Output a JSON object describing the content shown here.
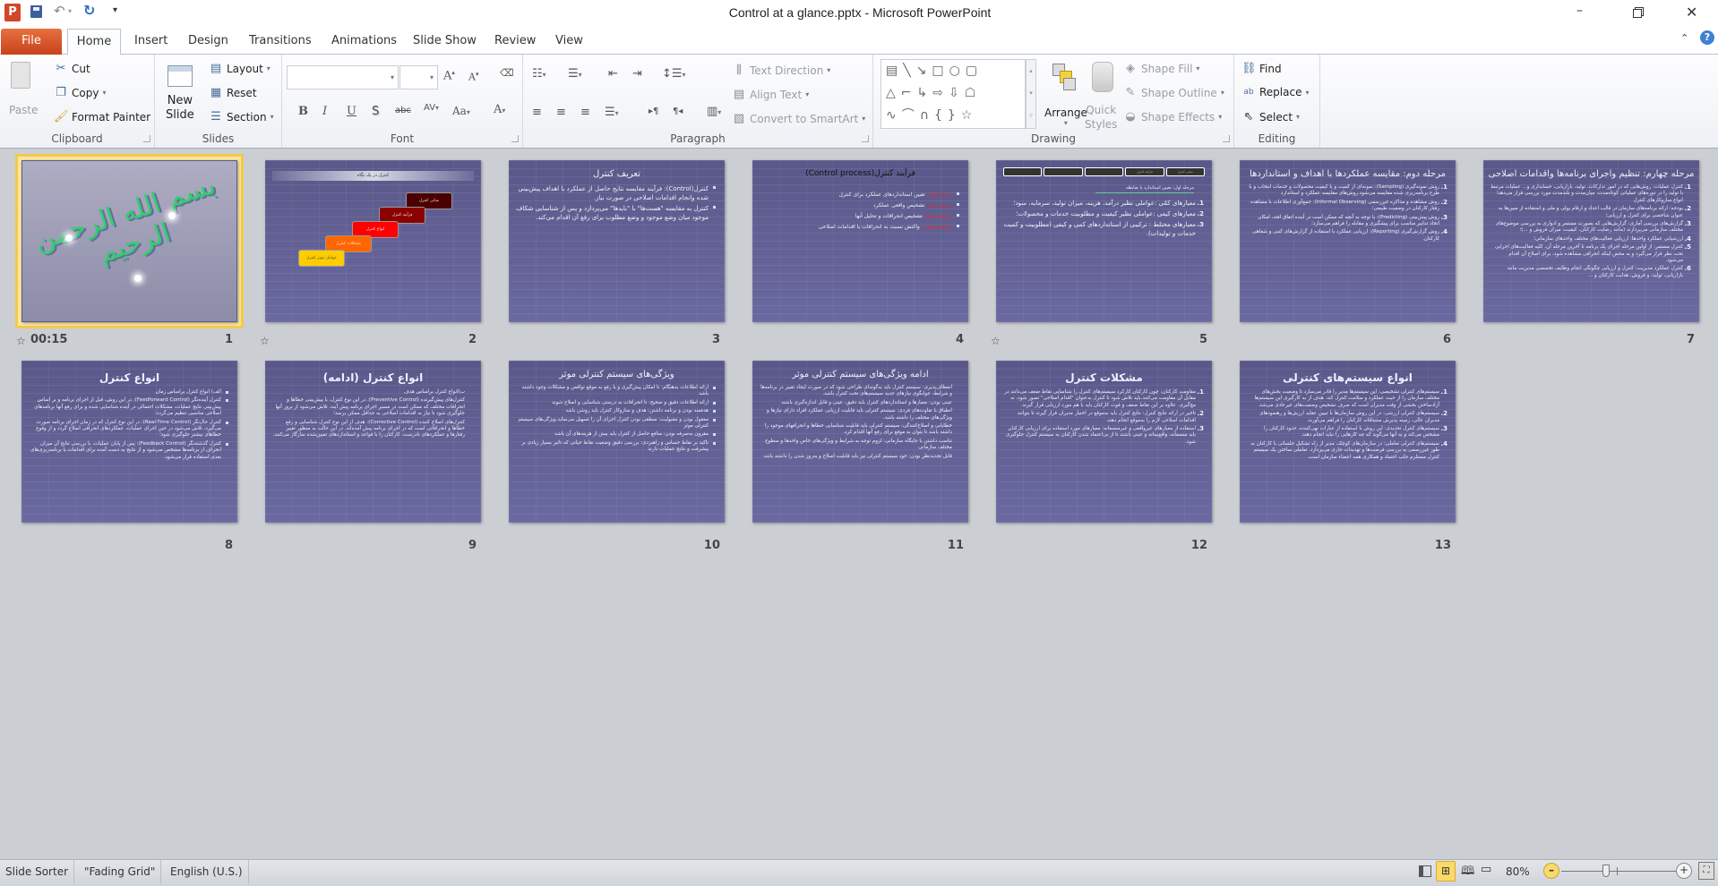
{
  "app": {
    "title": "Control at a glance.pptx  -  Microsoft PowerPoint",
    "logo": "P"
  },
  "quick_access": {
    "icons": [
      "save-icon",
      "undo-icon",
      "redo-icon",
      "customize-icon"
    ]
  },
  "tabs": [
    {
      "label": "File"
    },
    {
      "label": "Home",
      "active": true
    },
    {
      "label": "Insert"
    },
    {
      "label": "Design"
    },
    {
      "label": "Transitions"
    },
    {
      "label": "Animations"
    },
    {
      "label": "Slide Show"
    },
    {
      "label": "Review"
    },
    {
      "label": "View"
    }
  ],
  "ribbon": {
    "clipboard": {
      "label": "Clipboard",
      "paste": "Paste",
      "cut": "Cut",
      "copy": "Copy",
      "format_painter": "Format Painter"
    },
    "slides": {
      "label": "Slides",
      "new_slide_1": "New",
      "new_slide_2": "Slide",
      "layout": "Layout",
      "reset": "Reset",
      "section": "Section"
    },
    "font": {
      "label": "Font",
      "font_name": "",
      "font_size": ""
    },
    "paragraph": {
      "label": "Paragraph",
      "text_direction": "Text Direction",
      "align_text": "Align Text",
      "convert_smartart": "Convert to SmartArt"
    },
    "drawing": {
      "label": "Drawing",
      "arrange": "Arrange",
      "quick_styles_1": "Quick",
      "quick_styles_2": "Styles",
      "shape_fill": "Shape Fill",
      "shape_outline": "Shape Outline",
      "shape_effects": "Shape Effects"
    },
    "editing": {
      "label": "Editing",
      "find": "Find",
      "replace": "Replace",
      "select": "Select"
    }
  },
  "slides": [
    {
      "num": "1",
      "kind": "calligraphy",
      "calligraphy": "بسم الله الرحمن الرحیم",
      "timing": "00:15",
      "transition": true,
      "selected": true
    },
    {
      "num": "2",
      "kind": "steps",
      "header": "کنترل در یک نگاه",
      "transition": true,
      "steps": [
        {
          "label": "مبانی کنترل",
          "color": "#4a0000"
        },
        {
          "label": "فرآیند کنترل",
          "color": "#8b0000"
        },
        {
          "label": "انواع کنترل",
          "color": "#ff0000"
        },
        {
          "label": "مشکلات کنترل",
          "color": "#ff6600"
        },
        {
          "label": "عوامل موثر کنترل",
          "color": "#ffcc00"
        }
      ]
    },
    {
      "num": "3",
      "kind": "bullets",
      "large": true,
      "title": "تعریف کنترل",
      "bullets": [
        "کنترل(Control): فرآیند مقایسه نتایج حاصل از عملکرد با اهداف پیش‌بینی شده وانجام اقدامات اصلاحی در صورت نیاز.",
        "کنترل به مقایسه \"هست‌ها\" با \"بایدها\" می‌پردازد و پس از شناسایی شکاف موجود میان وضع موجود و وضع مطلوب برای رفع آن اقدام می‌کند."
      ]
    },
    {
      "num": "4",
      "kind": "stages",
      "title": "فرآیند کنترل(Control process)",
      "stages": [
        {
          "label": "مرحله اول:",
          "text": "تعیین استانداردهای عملکرد برای کنترل"
        },
        {
          "label": "مرحله دوم:",
          "text": "تشخیص واقعی عملکرد"
        },
        {
          "label": "مرحله سوم:",
          "text": "تشخیص انحرافات و تحلیل آنها"
        },
        {
          "label": "مرحله چهارم:",
          "text": "واکنش نسبت به انحرافات یا اقدامات اصلاحی"
        }
      ],
      "accent": "#ff2020"
    },
    {
      "num": "5",
      "kind": "nav",
      "transition": true,
      "nav": [
        "مبانی کنترل",
        "فرآیند کنترل",
        "",
        "",
        ""
      ],
      "subtitle": "مرحله اول: تعیین استاندارد یا ضابطه",
      "numbered": [
        "معیارهای کمّی :عواملی نظیر درآمد، هزینه، میزان تولید، سرمایه، سود؛",
        "معیارهای کیفی :عواملی نظیر کیفیت و مطلوبیت خدمات و محصولات؛",
        "معیارهای مختلط : ترکیبی از استانداردهای کمی و کیفی (مطلوبیت و کمیت خدمات و تولیدات)."
      ]
    },
    {
      "num": "6",
      "kind": "numbered",
      "title": "مرحله دوم: مقایسه عملکردها با اهداف و استانداردها",
      "numbered": [
        "روش نمونه‌گیری (Sampling): نمونه‌ای از کمیت و یا کیفیت محصولات و خدمات انتخاب و با طرح برنامه‌ریزی شده مقایسه می‌شود.روش‌های مقایسه عملکرد و استاندارد",
        "روش مشاهده و مذاکره غیررسمی (Informal Observing): جمع‌آوری اطلاعات با مشاهده رفتار کارکنان در وضعیت طبیعی؛",
        "روش پیش‌بینی (Predicting): با توجه به آنچه که ممکن است در آینده اتفاق افتد، امکان اتخاذ تدابیر مناسب برای پیشگیری و مقابله را فراهم می‌سازد؛",
        "روش گزارش‌گیری (Reporting): ارزیابی عملکرد با استفاده از گزارش‌های کتبی و شفاهی کارکنان."
      ]
    },
    {
      "num": "7",
      "kind": "numbered",
      "title": "مرحله چهارم: تنظیم واجرای برنامه‌ها واقدامات اصلاحی",
      "numbered": [
        "کنترل عملیات: روش‌هایی که در امور تدارکات، تولید، بازاریابی، حسابداری و... عملیات مرتبط با تولید را در دوره‌های عملیاتی کوتاه‌مدت، میان‌مدت و بلندمدت مورد بررسی قرار می‌دهد؛انواع سازوکارهای کنترل",
        "بودجه: ارائه برنامه‌های سازمان در قالب اعداد و ارقام پولی و ملی و استفاده از مبین‌ها به عنوان شاخصی برای کنترل و ارزیابی؛",
        "گزارش‌های بررسی آماری: گزارش‌هایی که بصورت مستمر و ادواری به بررسی موضوع‌های مختلف سازمانی می‌پردازند (مانند رضایت کارکنان، کیفیت، میزان فروش و ...)؛",
        "ارزشیابی عملکرد واحدها: ارزیابی فعالیت‌های مختلف واحدهای سازمانی؛",
        "کنترل مستمر: از اولین مرحله اجرای یک برنامه تا آخرین مرحله آن، کلیه فعالیت‌های اجرایی تحت نظر قرار می‌گیرد و به محض اینکه انحرافی مشاهده شود، برای اصلاح آن اقدام می‌شود.",
        "کنترل عملکرد مدیریت: کنترل و ارزیابی چگونگی انجام وظایف تخصصی مدیریت مانند بازاریابی، تولید، و فروش، هدایت کارکنان و ..."
      ]
    },
    {
      "num": "8",
      "kind": "bullets",
      "title": "انواع کنترل",
      "bigtitle": true,
      "bullets": [
        "الف) انواع کنترل براساس زمان",
        "کنترل آینده‌نگر (Feedforward Control): در این روش، قبل از اجرای برنامه و بر اساس پیش‌بینی نتایج عملیات، مشکلات احتمالی در آینده شناسایی شده و برای رفع آنها برنامه‌های اصلاحی مناسبی تنظیم می‌گردد؛",
        "کنترل حال‌نگر (Real-Time Control): در این نوع کنترل که در زمان اجرای برنامه صورت می‌گیرد، تلاش می‌شود در حین اجرای عملیات، عملکردهای انحرافی اصلاح گردد و از وقوع خطاهای بیشتر جلوگیری شود؛",
        "کنترل گذشته‌نگر (Feedback Control): پس از پایان عملیات، با بررسی نتایج آن میزان انحراف از برنامه‌ها مشخص می‌شود و از نتایج به دست آمده برای اقدامات یا برنامه‌ریزی‌های بعدی استفاده قرار می‌شود."
      ]
    },
    {
      "num": "9",
      "kind": "bullets",
      "title": "انواع کنترل (ادامه)",
      "bigtitle": true,
      "plain": true,
      "bullets": [
        "ب)انواع کنترل براساس هدف",
        "کنترل‌های پیش‌گیرنده (Preventive Control): در این نوع کنترل، با پیش‌بینی خطاها و انحرافات مختلف که ممکن است در مسیر اجرای برنامه پیش آیند، تلاش می‌شود از بروز آنها جلوگیری شود تا نیاز به اقدامات اصلاحی به حداقل ممکن برسد؛",
        "کنترل‌های اصلاح کننده (Corrective Control): هدف از این نوع کنترل شناسایی و رفع خطاها و انحرافاتی است که در اجرای برنامه پیش آمده‌اند. در این حالت به منظور تغییر رفتارها و عملکردهای نادرست، کارکنان را با قواعد و استانداردهای تعیین‌شده سازگار می‌کنند."
      ]
    },
    {
      "num": "10",
      "kind": "bullets",
      "title": "ویژگی‌های سیستم کنترلی موثر",
      "bullets": [
        "ارائه اطلاعات به‌هنگام: تا امکان پیش‌گیری و یا رفع به موقع نواقص و مشکلات وجود داشته باشد",
        "ارائه اطلاعات دقیق و صحیح: تا انحرافات به درستی شناسایی و اصلاح شوند",
        "هدفمند بودن و برنامه داشتن: هدف و سازوکار کنترل باید روشن باشد",
        "معقول بودن و مقبولیت: منطقی بودن کنترل اجرای آن را تسهیل می‌نماید.ویژگی‌های سیستم کنترلی موثر",
        "مقرون به‌صرفه بودن: منافع حاصل از کنترل باید بیش از هزینه‌های آن باشد",
        "تاکید بر نقاط حساس و راهبردی: بررسی دقیق وضعیت نقاط حیاتی که تاثیر بسیار زیادی بر پیشرفت و نتایج عملیات دارند"
      ]
    },
    {
      "num": "11",
      "kind": "paras",
      "title": "ادامه ویژگی‌های سیستم کنترلی موثر",
      "paras": [
        "انعطاف‌پذیری: سیستم کنترل باید به‌گونه‌ای طراحی شود که در صورت ایجاد تغییر در برنامه‌ها و شرایط، جوابگوی نیازهای جدید سیستم‌های تحت کنترل باشد.",
        "عینی بودن: معیارها و استانداردهای کنترل باید دقیق، عینی و قابل اندازه‌گیری باشند",
        "انطباق با تفاوت‌های فردی: سیستم کنترلی باید قابلیت ارزیابی عملکرد افراد دارای نیازها و ویژگی‌های مختلف را داشته باشد.",
        "خطایابی و اصلاح‌کنندگی: سیستم کنترلی باید قابلیت شناسایی خطاها و انحرافهای موجود را داشته باشد تا بتوان به موقع برای رفع آنها اقدام کرد.",
        "تناسب داشتن با جایگاه سازمانی: لزوم توجه به شرایط و ویژگی‌های خاص واحدها و سطوح مختلف سازمانی",
        "قابل تجدیدنظر بودن: خود سیستم کنترلی نیز باید قابلیت اصلاح و به‌روز شدن را داشته باشد"
      ]
    },
    {
      "num": "12",
      "kind": "numbered",
      "title": "مشکلات کنترل",
      "bigtitle": true,
      "numbered": [
        "مقاومت کارکنان: چون کارکنان کارکرد سیستم‌های کنترل را شناسایی نقاط ضعف می‌دانند در مقابل آن مقاومت می‌کنند.باید تلاش شود تا کنترل به‌عنوان \"اقدام اصلاحی\" تصور شود، نه مچ‌گیری. علاوه بر این نقاط ضعف و قوت کارکنان باید با هم مورد ارزیابی قرار گیرند.",
        "تاخیر در ارائه نتایج کنترل: نتایج کنترل باید به‌موقع در اختیار مدیران قرار گیرند تا بتوانند اقدامات اصلاحی لازم را به‌موقع انجام دهند.",
        "استفاده از معیارهای غیرواقعی و غیرمنصفانه: معیارهای مورد استفاده برای ارزیابی کارکنان باید منصفانه، واقع‌بینانه و عینی باشند تا از بی‌اعتماد شدن کارکنان به سیستم کنترل جلوگیری شود."
      ]
    },
    {
      "num": "13",
      "kind": "numbered",
      "title": "انواع سیستم‌های کنترلی",
      "bigtitle": true,
      "numbered": [
        "سیستم‌های کنترلی تشخیصی: این سیستم‌ها مدیر را قادر می‌سازد تا وضعیت بخش‌های مختلف سازمان را از حیث عملکرد و سلامت کنترل کند. هدف از به کارگیری این سیستم‌ها آزادساختن بخشی از وقت مدیران است که صرف تشخیص وضعیت‌های غیرعادی می‌شد.",
        "سیستم‌های کنترلی ارزشی: در این روش سازمان‌ها با تبیین عقاید ارزش‌ها و رهنمودهای مدیران عالی، زمینه پذیرش مشتاقانه کارکنان را فراهم می‌آورند.",
        "سیستم‌های کنترل تحدیدی: این روش با استفاده از عبارات نهی‌کننده، حدود کارکنان را مشخص می‌کند و به آنها می‌گوید که چه کارهایی را نباید انجام دهند.",
        "سیستم‌های کنترلی تعاملی: در سازمان‌های کوچک، مدیر از راه تشکیل جلساتی با کارکنان به طور غیررسمی به بررسی فرصت‌ها و تهدیدات جاری می‌پردازد. تعاملی ساختن یک سیستم کنترل مستلزم جلب اعتماد و همکاری همه اعضاء سازمان است."
      ]
    }
  ],
  "status": {
    "view": "Slide Sorter",
    "theme": "\"Fading Grid\"",
    "language": "English (U.S.)",
    "zoom_label": "80%",
    "zoom_percent": 80
  },
  "colors": {
    "file_tab": "#d24726",
    "selection": "#f2c94c",
    "slide_bg": "#5f5e93"
  }
}
